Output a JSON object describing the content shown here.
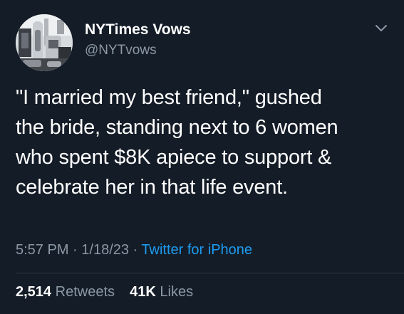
{
  "author": {
    "display_name": "NYTimes Vows",
    "handle": "@NYTvows",
    "avatar": "profile-photo"
  },
  "menu_icon": "chevron-down-icon",
  "tweet": {
    "lines": [
      "\"I married my best friend,\" gushed",
      "the bride, standing next to 6 women",
      "who spent $8K apiece to support &",
      "celebrate her in that life event."
    ]
  },
  "meta": {
    "time": "5:57 PM",
    "separator1": " · ",
    "date": "1/18/23",
    "separator2": " · ",
    "source": "Twitter for iPhone"
  },
  "stats": {
    "retweets_count": "2,514",
    "retweets_label": "Retweets",
    "likes_count": "41K",
    "likes_label": "Likes"
  },
  "colors": {
    "background": "#141c27",
    "text": "#ffffff",
    "secondary_text": "#8b98a5",
    "link": "#1d9bf0"
  }
}
